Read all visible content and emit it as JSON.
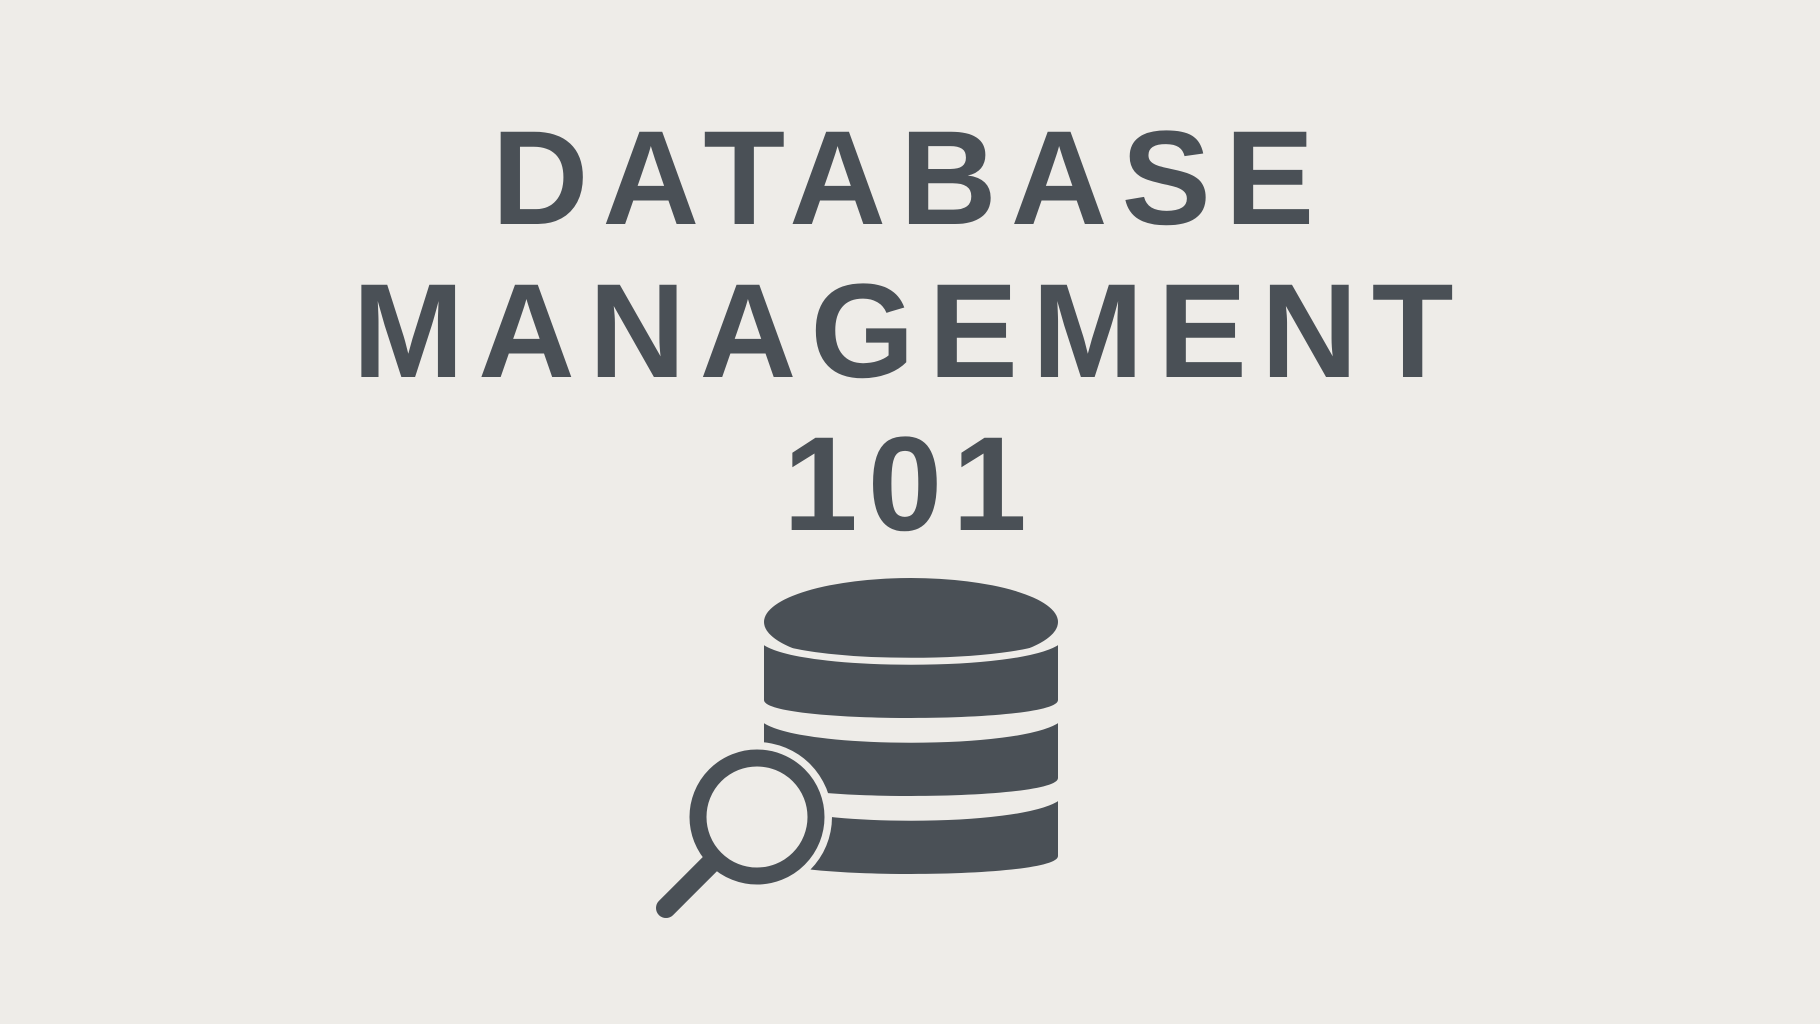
{
  "title": {
    "line1": "DATABASE",
    "line2": "MANAGEMENT",
    "line3": "101"
  },
  "icon": {
    "name": "database-search-icon",
    "color": "#4a5056"
  },
  "colors": {
    "background": "#eeece8",
    "text": "#4a5056"
  }
}
